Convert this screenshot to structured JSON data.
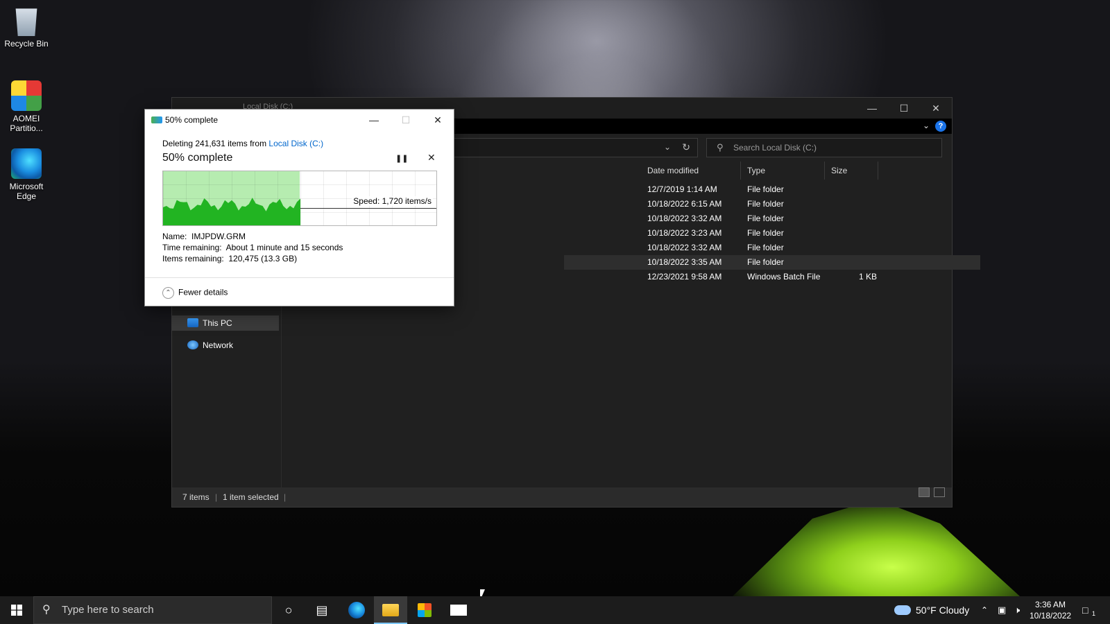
{
  "desktop": {
    "icons": [
      {
        "label": "Recycle Bin",
        "icon": "recycle-bin-icon"
      },
      {
        "label": "AOMEI Partitio...",
        "icon": "aomei-partition-icon"
      },
      {
        "label": "Microsoft Edge",
        "icon": "edge-icon"
      }
    ]
  },
  "explorer": {
    "title": "Local Disk (C:)",
    "search_placeholder": "Search Local Disk (C:)",
    "columns": [
      "Date modified",
      "Type",
      "Size"
    ],
    "rows": [
      {
        "date": "12/7/2019 1:14 AM",
        "type": "File folder",
        "size": ""
      },
      {
        "date": "10/18/2022 6:15 AM",
        "type": "File folder",
        "size": ""
      },
      {
        "date": "10/18/2022 3:32 AM",
        "type": "File folder",
        "size": ""
      },
      {
        "date": "10/18/2022 3:23 AM",
        "type": "File folder",
        "size": ""
      },
      {
        "date": "10/18/2022 3:32 AM",
        "type": "File folder",
        "size": ""
      },
      {
        "date": "10/18/2022 3:35 AM",
        "type": "File folder",
        "size": ""
      },
      {
        "date": "12/23/2021 9:58 AM",
        "type": "Windows Batch File",
        "size": "1 KB"
      }
    ],
    "selected_row": 5,
    "nav": [
      {
        "label": "This PC",
        "icon": "this-pc-icon",
        "selected": true
      },
      {
        "label": "Network",
        "icon": "network-icon",
        "selected": false
      }
    ],
    "status": {
      "items": "7 items",
      "selected": "1 item selected"
    }
  },
  "dialog": {
    "title": "50% complete",
    "line_prefix": "Deleting 241,631 items from ",
    "line_link": "Local Disk (C:)",
    "heading": "50% complete",
    "progress": 0.5,
    "speed": "Speed: 1,720 items/s",
    "name_label": "Name:",
    "name_value": "IMJPDW.GRM",
    "time_label": "Time remaining:",
    "time_value": "About 1 minute and 15 seconds",
    "items_label": "Items remaining:",
    "items_value": "120,475 (13.3 GB)",
    "fewer_details": "Fewer details"
  },
  "taskbar": {
    "search_placeholder": "Type here to search",
    "weather": "50°F  Cloudy",
    "time": "3:36 AM",
    "date": "10/18/2022",
    "notification_count": "1"
  },
  "colors": {
    "accent": "#0066cc",
    "progress_fill": "#b6ecb0",
    "progress_graph": "#22b422"
  }
}
